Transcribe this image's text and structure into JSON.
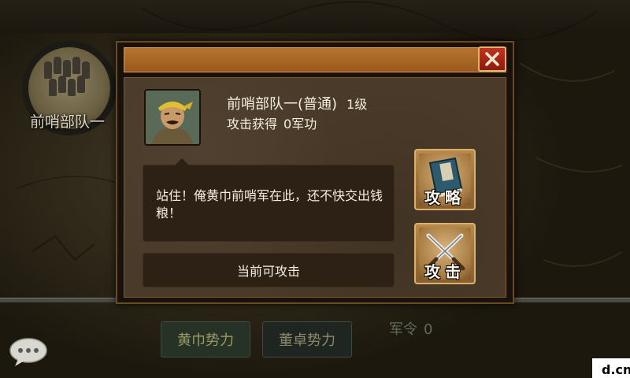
{
  "map": {
    "unit_label": "前哨部队一"
  },
  "factions": {
    "yellow_turban": "黄巾势力",
    "dong_zhuo": "董卓势力"
  },
  "army_order": {
    "label": "军令",
    "value": "0"
  },
  "watermark": "d.cn",
  "dialog": {
    "unit_name": "前哨部队一(普通)",
    "unit_level": "1级",
    "reward_label": "攻击获得",
    "reward_value": "0军功",
    "speech": "站住！俺黄巾前哨军在此，还不快交出钱粮！",
    "status": "当前可攻击",
    "strategy_label": "攻略",
    "attack_label": "攻击"
  },
  "colors": {
    "title_bar": "#b7742e",
    "close_button": "#c2321f",
    "panel_body": "#4a3a29",
    "text_cream": "#f3eedf"
  },
  "icons": {
    "close": "close-x-icon",
    "chat": "chat-bubble-icon",
    "strategy": "book-icon",
    "attack": "crossed-swords-icon"
  }
}
